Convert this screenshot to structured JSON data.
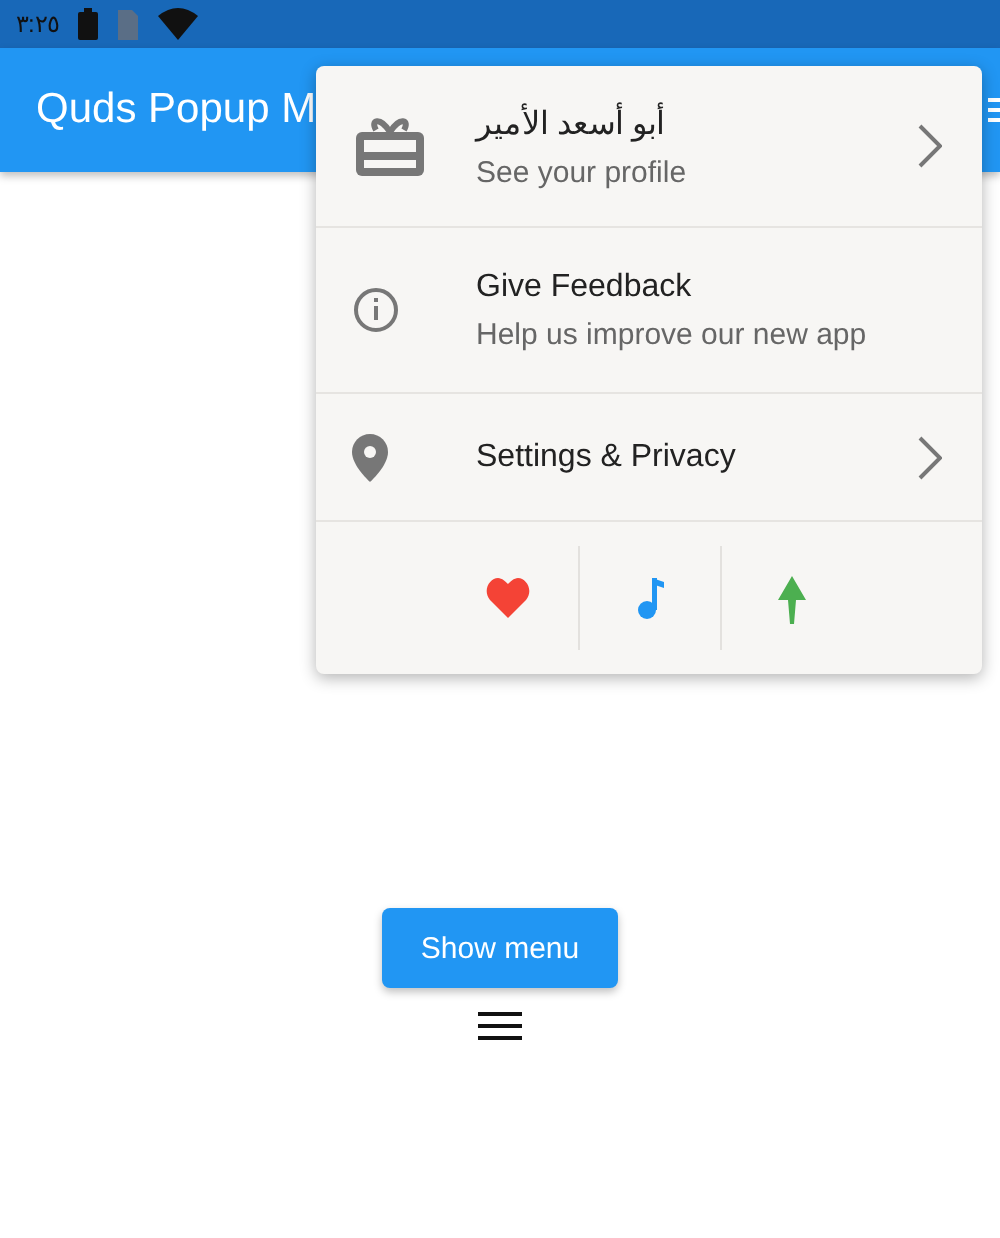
{
  "status_bar": {
    "time": "٣:٢٥"
  },
  "app_bar": {
    "title": "Quds Popup M"
  },
  "popup": {
    "items": [
      {
        "title": "أبو أسعد الأمير",
        "subtitle": "See your profile",
        "chevron": true
      },
      {
        "title": "Give Feedback",
        "subtitle": "Help us improve our new app",
        "chevron": false
      },
      {
        "title": "Settings & Privacy",
        "chevron": true
      }
    ],
    "actions": [
      {
        "color": "#f44336"
      },
      {
        "color": "#2196f3"
      },
      {
        "color": "#4caf50"
      }
    ]
  },
  "button": {
    "label": "Show menu"
  }
}
